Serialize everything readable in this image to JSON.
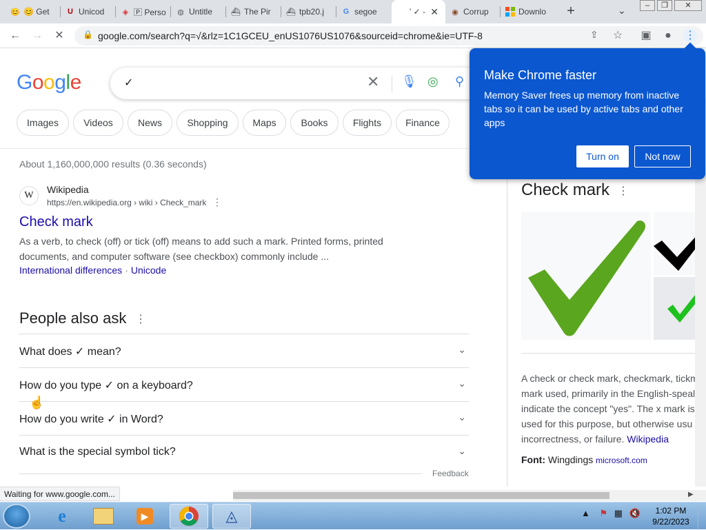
{
  "browser": {
    "tabs": [
      {
        "icon": "emoji-icon",
        "label": "😊 Get"
      },
      {
        "icon": "unicode-icon",
        "label": "Unicod"
      },
      {
        "icon": "perso-icon",
        "label": "🄿 Perso"
      },
      {
        "icon": "globe-icon",
        "label": "Untitle"
      },
      {
        "icon": "pirate-icon",
        "label": "The Pir"
      },
      {
        "icon": "pirate-icon",
        "label": "tpb20.j"
      },
      {
        "icon": "google-icon",
        "label": "segoe"
      },
      {
        "icon": "google-icon",
        "label": "' ✓ -",
        "active": true
      },
      {
        "icon": "corrupt-icon",
        "label": "Corrup"
      },
      {
        "icon": "windows-icon",
        "label": "Downlo"
      }
    ],
    "url": "google.com/search?q=√&rlz=1C1GCEU_enUS1076US1076&sourceid=chrome&ie=UTF-8",
    "status_text": "Waiting for www.google.com..."
  },
  "search": {
    "logo": "Google",
    "query": "✓",
    "chips": [
      "Images",
      "Videos",
      "News",
      "Shopping",
      "Maps",
      "Books",
      "Flights",
      "Finance"
    ],
    "stats": "About 1,160,000,000 results (0.36 seconds)"
  },
  "result": {
    "favicon_letter": "W",
    "site": "Wikipedia",
    "url": "https://en.wikipedia.org › wiki › Check_mark",
    "title": "Check mark",
    "snippet": "As a verb, to check (off) or tick (off) means to add such a mark. Printed forms, printed documents, and computer software (see checkbox) commonly include ...",
    "link1": "International differences",
    "link2": "Unicode"
  },
  "paa": {
    "title": "People also ask",
    "questions": [
      "What does ✓ mean?",
      "How do you type ✓ on a keyboard?",
      "How do you write ✓ in Word?",
      "What is the special symbol tick?"
    ],
    "feedback": "Feedback"
  },
  "knowledge_panel": {
    "title": "Check mark",
    "desc_lines": [
      "A check or check mark, checkmark, tickm",
      "mark used, primarily in the English-speal",
      "indicate the concept \"yes\". The x mark is",
      "used for this purpose, but otherwise usu",
      "incorrectness, or failure."
    ],
    "desc_link": "Wikipedia",
    "font_label": "Font:",
    "font_value": "Wingdings",
    "font_source": "microsoft.com"
  },
  "popup": {
    "title": "Make Chrome faster",
    "body": "Memory Saver frees up memory from inactive tabs so it can be used by active tabs and other apps",
    "turn_on": "Turn on",
    "not_now": "Not now"
  },
  "taskbar": {
    "time": "1:02 PM",
    "date": "9/22/2023"
  },
  "colors": {
    "popup_blue": "#0b57d0",
    "link_blue": "#1a0dab",
    "check_green": "#5aa61e"
  }
}
